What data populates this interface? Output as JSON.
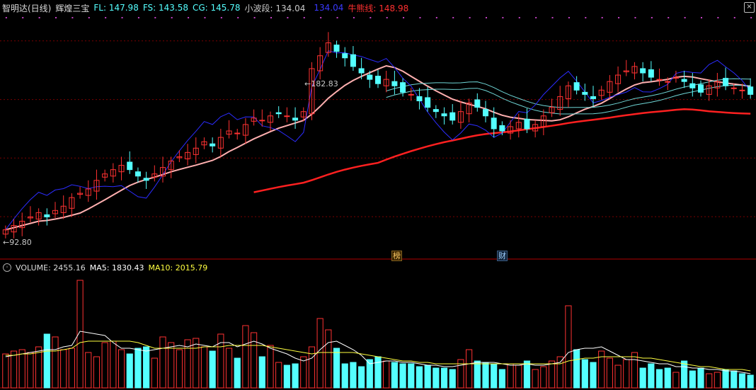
{
  "header": {
    "indicator_name": "智明达(日线)",
    "formula_name": "辉煌三宝",
    "fl": "FL: 147.98",
    "fs": "FS: 143.58",
    "cg": "CG: 145.78",
    "wave_label": "小波段: 134.04",
    "wave_value": "134.04",
    "bull_line": "牛熊线: 148.98"
  },
  "annotations": {
    "high": "182.83",
    "low": "92.80",
    "badge_1": "榜",
    "badge_2": "财"
  },
  "volume_header": {
    "volume": "VOLUME: 2455.16",
    "ma5": "MA5: 1830.43",
    "ma10": "MA10: 2015.79"
  },
  "colors": {
    "up": "#ff3232",
    "down": "#54ffff",
    "grid": "#7a0000",
    "ma_pink": "#ffb0b0",
    "bull_line": "#ff2020",
    "wave_blue": "#2c2cff",
    "ma5_vol": "#ffffff",
    "ma10_vol": "#ffff40",
    "fl": "#54ffff",
    "fs": "#54ffff",
    "cg": "#54ffff",
    "wave_label": "#c8c8c8",
    "wave_value": "#3a3aff",
    "bull_text": "#ff3030"
  },
  "chart_data": {
    "type": "candlestick",
    "y_price_range": [
      86,
      196
    ],
    "close_series": [
      95,
      97,
      99,
      101,
      103,
      101,
      104,
      106,
      110,
      112,
      114,
      118,
      121,
      123,
      125,
      123,
      120,
      118,
      121,
      124,
      127,
      129,
      131,
      133,
      136,
      134,
      138,
      141,
      140,
      144,
      147,
      146,
      148,
      149,
      148,
      146,
      150,
      170,
      176,
      182,
      178,
      175,
      171,
      168,
      165,
      163,
      165,
      162,
      159,
      158,
      155,
      152,
      150,
      148,
      146,
      150,
      154,
      152,
      148,
      142,
      141,
      143,
      145,
      142,
      144,
      148,
      152,
      157,
      162,
      160,
      158,
      156,
      160,
      164,
      167,
      169,
      171,
      168,
      166,
      165,
      164,
      166,
      164,
      161,
      159,
      162,
      164,
      162,
      161,
      160,
      158
    ],
    "volume_range": [
      0,
      8000
    ],
    "volume_series": [
      2400,
      2600,
      2700,
      2500,
      2900,
      3800,
      3600,
      2700,
      2800,
      7600,
      2500,
      2200,
      3200,
      3300,
      2700,
      2400,
      2800,
      2900,
      2100,
      3600,
      3200,
      2700,
      3400,
      3500,
      2900,
      2600,
      3800,
      2800,
      2100,
      4400,
      3900,
      2200,
      3000,
      1800,
      1600,
      1700,
      2200,
      2900,
      4900,
      4100,
      2800,
      1700,
      1800,
      1500,
      2000,
      2200,
      1900,
      1800,
      1700,
      1700,
      1500,
      1600,
      1400,
      1400,
      1300,
      2000,
      2700,
      1900,
      1800,
      1700,
      1300,
      1700,
      1600,
      1900,
      1300,
      1500,
      1900,
      2200,
      5800,
      2700,
      2000,
      1800,
      2600,
      2100,
      1600,
      2000,
      2500,
      1400,
      1700,
      1300,
      1400,
      1100,
      1900,
      1200,
      1400,
      1000,
      1100,
      1300,
      1200,
      1000,
      900
    ],
    "ma5": [
      2200,
      2300,
      2400,
      2500,
      2600,
      2700,
      2700,
      2900,
      3000,
      4000,
      3900,
      3800,
      3700,
      3200,
      2800,
      2800,
      2700,
      2600,
      2700,
      2800,
      2900,
      3000,
      2900,
      3100,
      3000,
      2900,
      3200,
      3200,
      2900,
      3100,
      3300,
      3100,
      2800,
      2600,
      2400,
      2100,
      1900,
      2100,
      2700,
      3200,
      3300,
      3000,
      2700,
      2300,
      1700,
      1800,
      1900,
      1900,
      1800,
      1800,
      1700,
      1600,
      1600,
      1500,
      1500,
      1600,
      1700,
      1800,
      1800,
      1800,
      1700,
      1600,
      1600,
      1700,
      1600,
      1600,
      1700,
      1800,
      2500,
      2700,
      2800,
      2800,
      2900,
      2600,
      2300,
      2000,
      2000,
      1900,
      1800,
      1700,
      1700,
      1500,
      1500,
      1400,
      1400,
      1300,
      1300,
      1200,
      1200,
      1100,
      1000
    ],
    "ma10": [
      2300,
      2300,
      2400,
      2400,
      2500,
      2600,
      2600,
      2700,
      2800,
      3200,
      3300,
      3300,
      3300,
      3300,
      3300,
      3300,
      3200,
      3000,
      2800,
      2800,
      2800,
      2800,
      2800,
      2800,
      2900,
      2900,
      2900,
      3000,
      3000,
      3000,
      3000,
      3000,
      2900,
      2800,
      2700,
      2600,
      2500,
      2400,
      2500,
      2500,
      2500,
      2500,
      2500,
      2400,
      2300,
      2200,
      2100,
      2000,
      1900,
      1900,
      1800,
      1800,
      1700,
      1700,
      1700,
      1700,
      1700,
      1700,
      1700,
      1700,
      1700,
      1700,
      1700,
      1700,
      1700,
      1700,
      1700,
      1700,
      1900,
      2000,
      2100,
      2100,
      2200,
      2200,
      2200,
      2200,
      2200,
      2100,
      2100,
      2000,
      1900,
      1800,
      1700,
      1600,
      1500,
      1500,
      1400,
      1300,
      1300,
      1300,
      1200
    ],
    "hlines_price": [
      101.1,
      128.4,
      155.6,
      182.9
    ]
  }
}
